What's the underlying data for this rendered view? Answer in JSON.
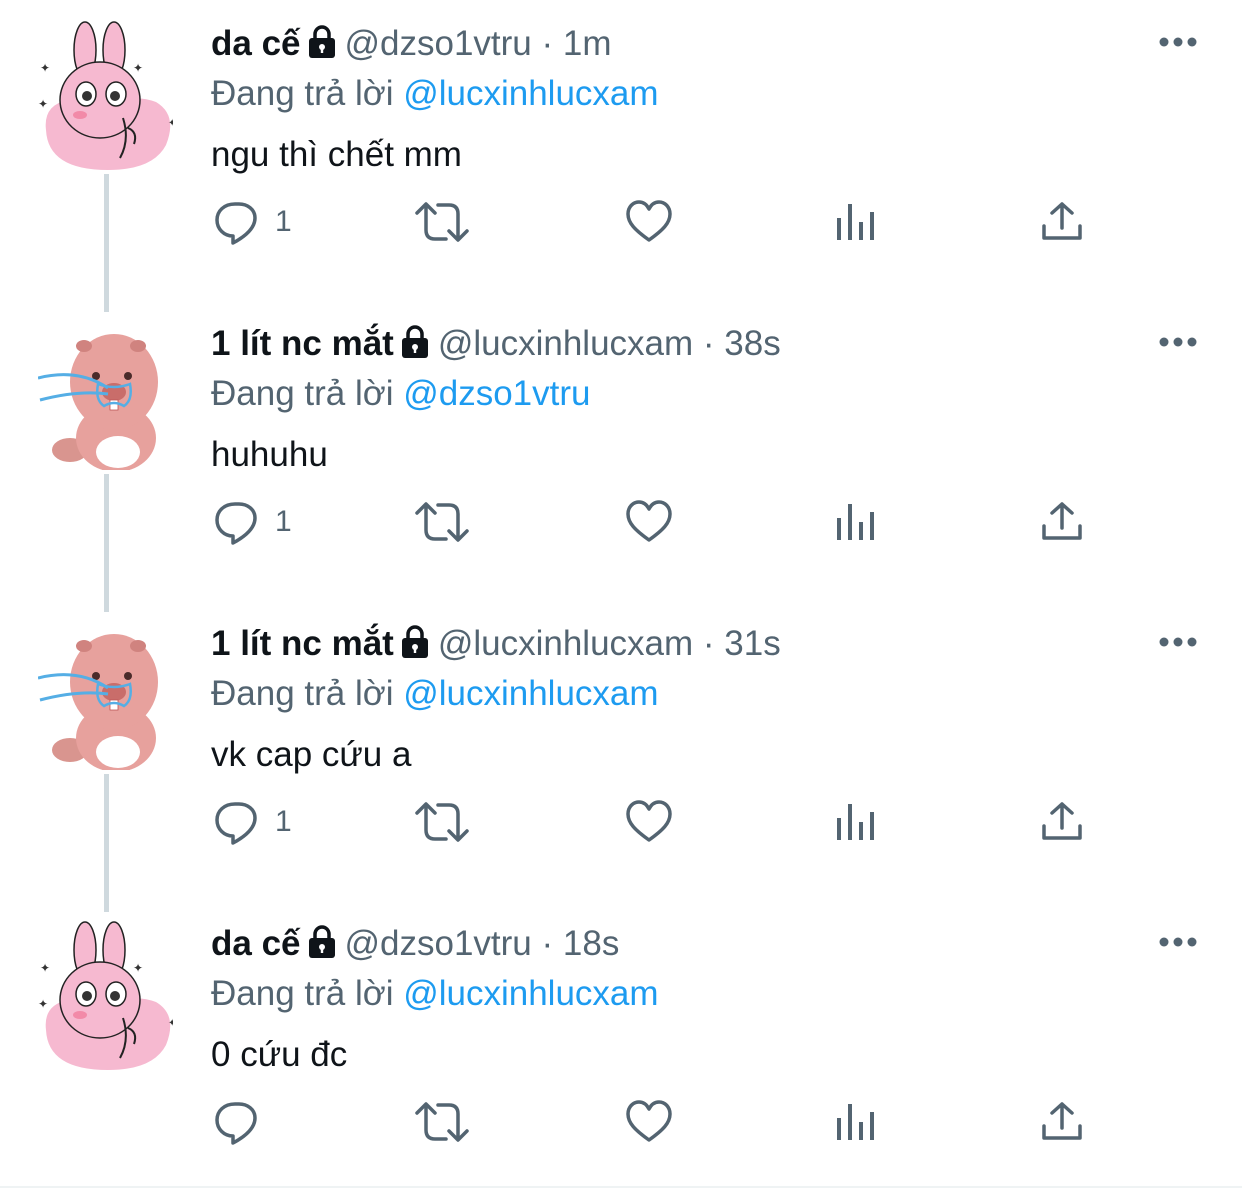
{
  "reply_prefix": "Đang trả lời",
  "colors": {
    "accent": "#1d9bf0",
    "secondary_text": "#536471",
    "thread_line": "#cfd9de"
  },
  "tweets": [
    {
      "avatar": "pink-bunny-avatar",
      "name": "da cế",
      "handle": "@dzso1vtru",
      "dot": "·",
      "time": "1m",
      "reply_to": "@lucxinhlucxam",
      "text": "ngu thì chết mm",
      "reply_count": "1"
    },
    {
      "avatar": "crying-beaver-avatar",
      "name": "1 lít nc mắt",
      "handle": "@lucxinhlucxam",
      "dot": "·",
      "time": "38s",
      "reply_to": "@dzso1vtru",
      "text": "huhuhu",
      "reply_count": "1"
    },
    {
      "avatar": "crying-beaver-avatar",
      "name": "1 lít nc mắt",
      "handle": "@lucxinhlucxam",
      "dot": "·",
      "time": "31s",
      "reply_to": "@lucxinhlucxam",
      "text": "vk cap cứu a",
      "reply_count": "1"
    },
    {
      "avatar": "pink-bunny-avatar",
      "name": "da cế",
      "handle": "@dzso1vtru",
      "dot": "·",
      "time": "18s",
      "reply_to": "@lucxinhlucxam",
      "text": "0 cứu đc",
      "reply_count": ""
    }
  ]
}
